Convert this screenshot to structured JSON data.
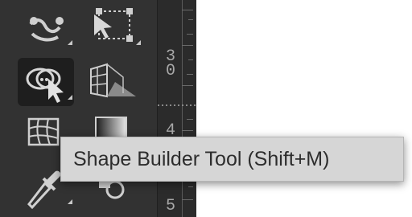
{
  "toolbar": {
    "tools": [
      {
        "name": "puppet-warp-icon",
        "selected": false
      },
      {
        "name": "free-transform-icon",
        "selected": false
      },
      {
        "name": "shape-builder-icon",
        "selected": true
      },
      {
        "name": "perspective-grid-icon",
        "selected": false
      },
      {
        "name": "mesh-icon",
        "selected": false
      },
      {
        "name": "gradient-icon",
        "selected": false
      },
      {
        "name": "eyedropper-icon",
        "selected": false
      },
      {
        "name": "blend-icon",
        "selected": false
      }
    ]
  },
  "ruler": {
    "top_label": "3\n0",
    "mid_label": "4",
    "bottom_label": "5"
  },
  "tooltip": {
    "text": "Shape Builder Tool (Shift+M)"
  }
}
